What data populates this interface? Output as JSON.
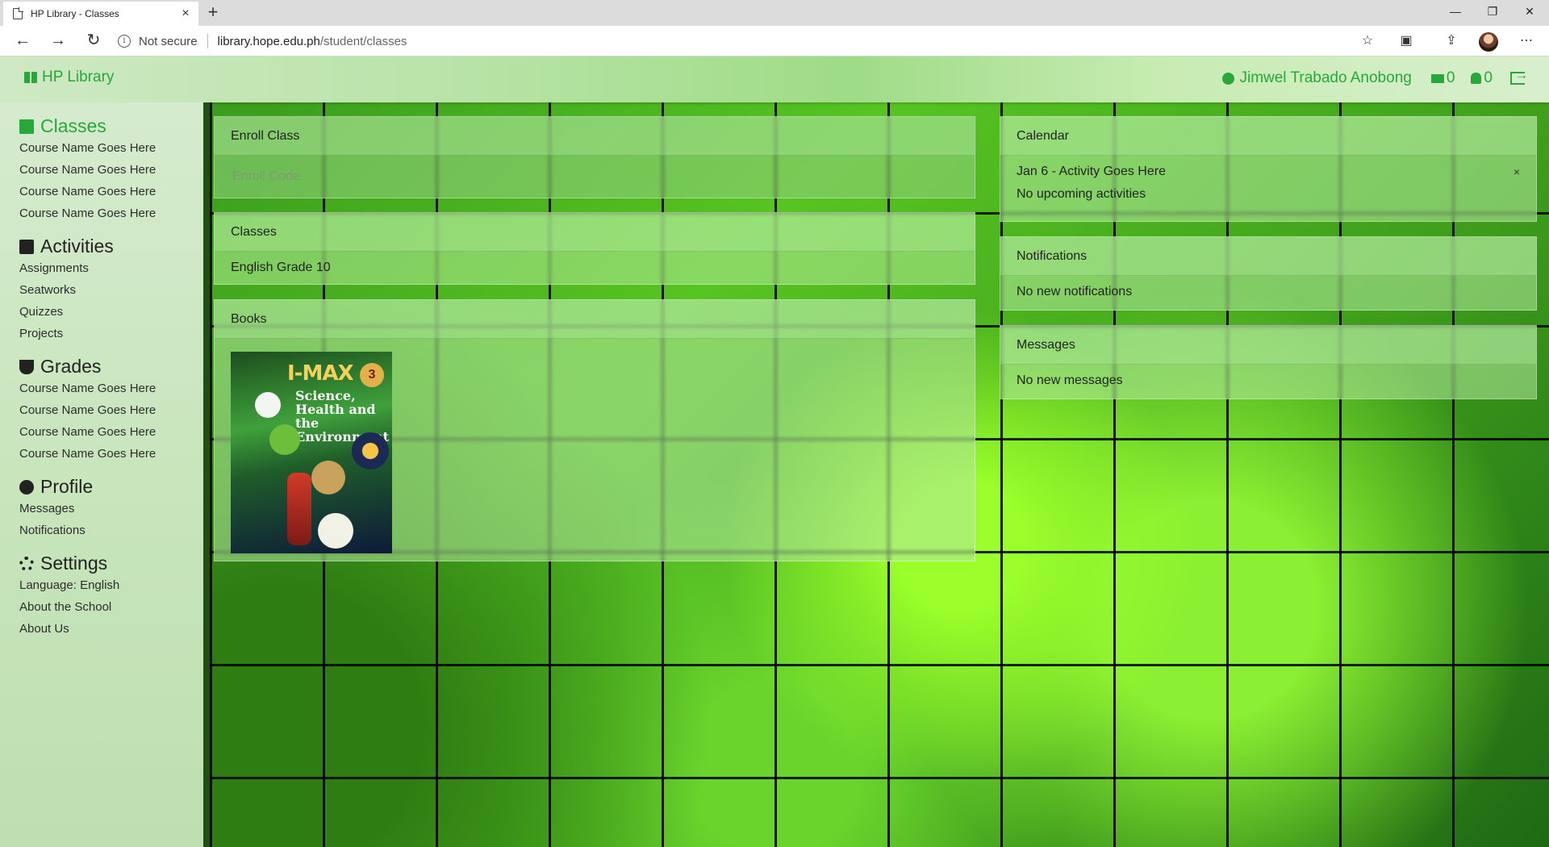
{
  "browser": {
    "tab_title": "HP Library - Classes",
    "tab_close": "×",
    "new_tab": "+",
    "security_label": "Not secure",
    "url_host": "library.hope.edu.ph",
    "url_path": "/student/classes"
  },
  "nav": {
    "brand": "HP Library",
    "user_name": "Jimwel Trabado Anobong",
    "messages_count": "0",
    "notifications_count": "0"
  },
  "sidebar": {
    "classes": {
      "title": "Classes",
      "items": [
        "Course Name Goes Here",
        "Course Name Goes Here",
        "Course Name Goes Here",
        "Course Name Goes Here"
      ]
    },
    "activities": {
      "title": "Activities",
      "items": [
        "Assignments",
        "Seatworks",
        "Quizzes",
        "Projects"
      ]
    },
    "grades": {
      "title": "Grades",
      "items": [
        "Course Name Goes Here",
        "Course Name Goes Here",
        "Course Name Goes Here",
        "Course Name Goes Here"
      ]
    },
    "profile": {
      "title": "Profile",
      "items": [
        "Messages",
        "Notifications"
      ]
    },
    "settings": {
      "title": "Settings",
      "items": [
        "Language: English",
        "About the School",
        "About Us"
      ]
    }
  },
  "main": {
    "enroll": {
      "header": "Enroll Class",
      "placeholder": "Enroll Code"
    },
    "classes": {
      "header": "Classes",
      "items": [
        "English Grade 10"
      ]
    },
    "books": {
      "header": "Books",
      "cover": {
        "brand": "I-MAX",
        "level": "3",
        "subtitle": "Science, Health and the Environment"
      }
    }
  },
  "right": {
    "calendar": {
      "header": "Calendar",
      "activity": "Jan 6 - Activity Goes Here",
      "close": "×",
      "empty": "No upcoming activities"
    },
    "notifications": {
      "header": "Notifications",
      "empty": "No new notifications"
    },
    "messages": {
      "header": "Messages",
      "empty": "No new messages"
    }
  }
}
